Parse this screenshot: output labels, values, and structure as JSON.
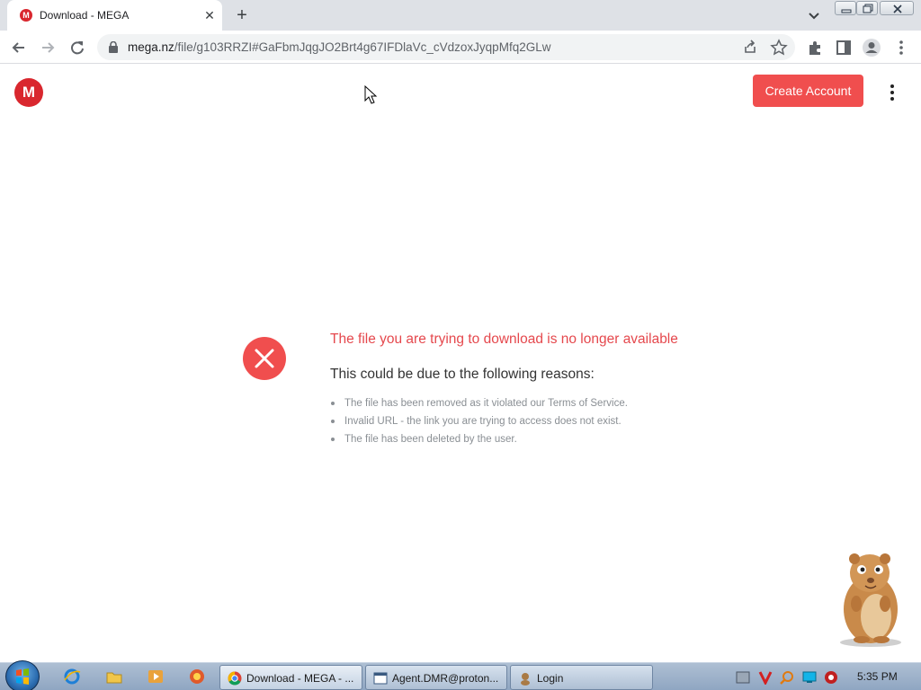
{
  "browser": {
    "tab": {
      "title": "Download - MEGA",
      "favicon": "M"
    },
    "url": {
      "host": "mega.nz",
      "path": "/file/g103RRZI#GaFbmJqgJO2Brt4g67IFDlaVc_cVdzoxJyqpMfq2GLw"
    }
  },
  "page": {
    "logo": "M",
    "create_account_label": "Create Account",
    "error_title": "The file you are trying to download is no longer available",
    "reasons_heading": "This could be due to the following reasons:",
    "reasons": [
      "The file has been removed as it violated our Terms of Service.",
      "Invalid URL - the link you are trying to access does not exist.",
      "The file has been deleted by the user."
    ]
  },
  "taskbar": {
    "tasks": [
      {
        "label": "Download - MEGA - ...",
        "icon": "chrome-icon"
      },
      {
        "label": "Agent.DMR@proton...",
        "icon": "window-icon"
      },
      {
        "label": "Login",
        "icon": "app-icon"
      }
    ],
    "clock": "5:35 PM"
  },
  "colors": {
    "accent": "#f04e4e",
    "mega_red": "#d9272e",
    "error_text": "#e5484d"
  }
}
